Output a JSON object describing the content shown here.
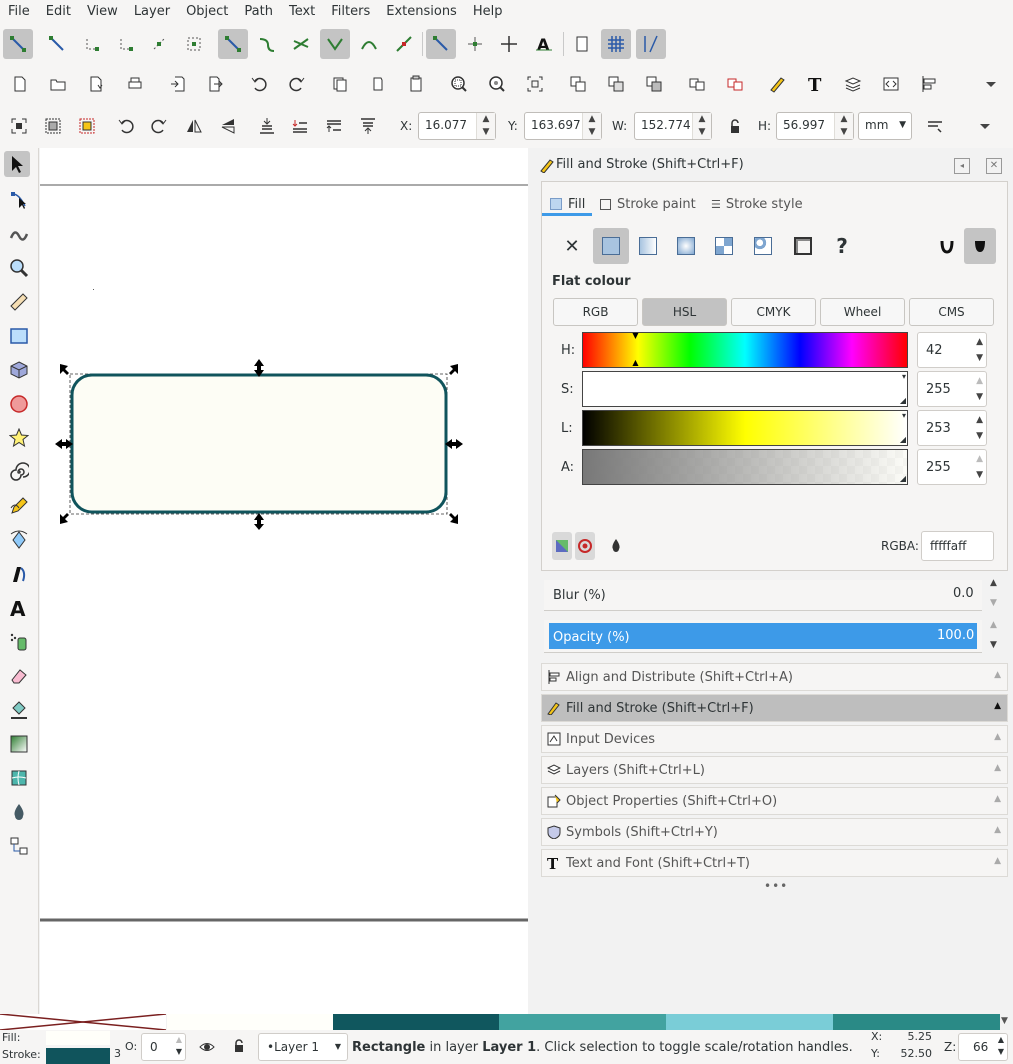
{
  "menu": [
    "File",
    "Edit",
    "View",
    "Layer",
    "Object",
    "Path",
    "Text",
    "Filters",
    "Extensions",
    "Help"
  ],
  "toolbar_coords": {
    "x_label": "X:",
    "x_value": "16.077",
    "y_label": "Y:",
    "y_value": "163.697",
    "w_label": "W:",
    "w_value": "152.774",
    "h_label": "H:",
    "h_value": "56.997",
    "unit": "mm"
  },
  "dialog": {
    "title": "Fill and Stroke (Shift+Ctrl+F)",
    "tabs": [
      "Fill",
      "Stroke paint",
      "Stroke style"
    ],
    "paint_help": "?",
    "section": "Flat colour",
    "modes": [
      "RGB",
      "HSL",
      "CMYK",
      "Wheel",
      "CMS"
    ],
    "active_mode": "HSL",
    "channels": [
      {
        "label": "H:",
        "value": "42"
      },
      {
        "label": "S:",
        "value": "255"
      },
      {
        "label": "L:",
        "value": "253"
      },
      {
        "label": "A:",
        "value": "255"
      }
    ],
    "rgba_label": "RGBA:",
    "rgba_value": "fffffaff",
    "blur_label": "Blur (%)",
    "blur_value": "0.0",
    "opacity_label": "Opacity (%)",
    "opacity_value": "100.0"
  },
  "panels": [
    "Align and Distribute (Shift+Ctrl+A)",
    "Fill and Stroke (Shift+Ctrl+F)",
    "Input Devices",
    "Layers (Shift+Ctrl+L)",
    "Object Properties (Shift+Ctrl+O)",
    "Symbols (Shift+Ctrl+Y)",
    "Text and Font (Shift+Ctrl+T)"
  ],
  "colors": {
    "rect_fill": "#fdfdf5",
    "rect_stroke": "#10545c",
    "accent": "#3d9ae8",
    "palette": [
      "#fffffa",
      "#10575e",
      "#42a3a0",
      "#7acdd7",
      "#2a8a86"
    ]
  },
  "status": {
    "fill_label": "Fill:",
    "stroke_label": "Stroke:",
    "stroke_width": "3",
    "opacity_label": "O:",
    "opacity_value": "0",
    "layer": "•Layer 1",
    "msg_obj": "Rectangle",
    "msg_mid": " in layer ",
    "msg_layer": "Layer 1",
    "msg_end": ". Click selection to toggle scale/rotation handles.",
    "x_label": "X:",
    "x_value": "5.25",
    "y_label": "Y:",
    "y_value": "52.50",
    "z_label": "Z:",
    "z_value": "66"
  }
}
